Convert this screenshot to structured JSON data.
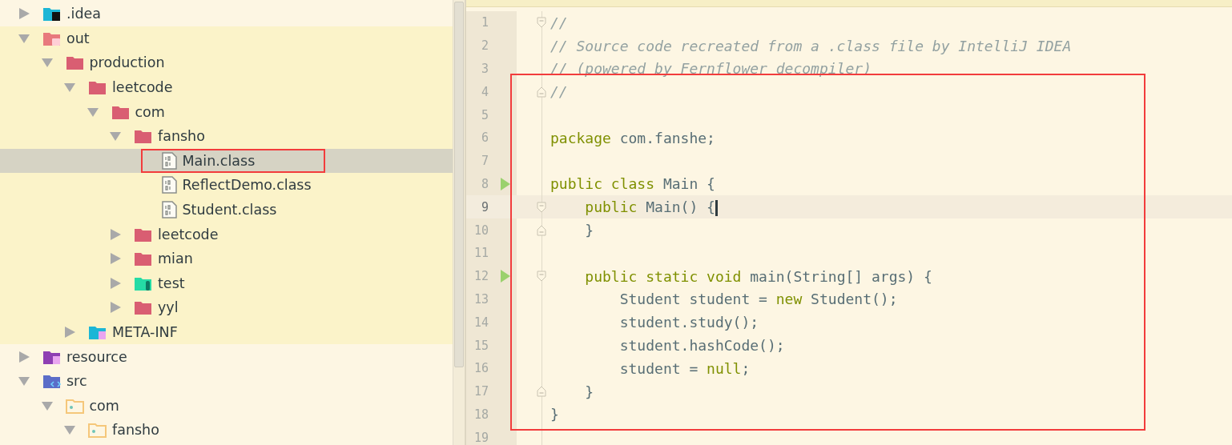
{
  "project_tree": {
    "items": [
      {
        "label": ".idea",
        "kind": "idea-folder",
        "expanded": false,
        "selected": false
      },
      {
        "label": "out",
        "kind": "excluded-folder",
        "expanded": true,
        "selected": false,
        "highlighted": true,
        "children": [
          {
            "label": "production",
            "kind": "folder",
            "expanded": true,
            "selected": false,
            "children": [
              {
                "label": "leetcode",
                "kind": "folder",
                "expanded": true,
                "selected": false,
                "children": [
                  {
                    "label": "com",
                    "kind": "folder",
                    "expanded": true,
                    "selected": false,
                    "children": [
                      {
                        "label": "fansho",
                        "kind": "folder",
                        "expanded": true,
                        "selected": false,
                        "children": [
                          {
                            "label": "Main.class",
                            "kind": "class-file",
                            "selected": true,
                            "boxed": true
                          },
                          {
                            "label": "ReflectDemo.class",
                            "kind": "class-file",
                            "selected": false
                          },
                          {
                            "label": "Student.class",
                            "kind": "class-file",
                            "selected": false
                          }
                        ]
                      },
                      {
                        "label": "leetcode",
                        "kind": "folder",
                        "expanded": false,
                        "selected": false
                      },
                      {
                        "label": "mian",
                        "kind": "folder",
                        "expanded": false,
                        "selected": false
                      },
                      {
                        "label": "test",
                        "kind": "test-folder",
                        "expanded": false,
                        "selected": false
                      },
                      {
                        "label": "yyl",
                        "kind": "folder",
                        "expanded": false,
                        "selected": false
                      }
                    ]
                  }
                ]
              },
              {
                "label": "META-INF",
                "kind": "meta-folder",
                "expanded": false,
                "selected": false
              }
            ]
          }
        ]
      },
      {
        "label": "resource",
        "kind": "resource-folder",
        "expanded": false,
        "selected": false
      },
      {
        "label": "src",
        "kind": "source-folder",
        "expanded": true,
        "selected": false,
        "children": [
          {
            "label": "com",
            "kind": "package",
            "expanded": true,
            "selected": false,
            "children": [
              {
                "label": "fansho",
                "kind": "package",
                "expanded": true,
                "selected": false
              }
            ]
          }
        ]
      }
    ]
  },
  "editor": {
    "boxed": true,
    "lines": [
      {
        "number": "1",
        "current": false,
        "fold_open": true,
        "tokens": [
          {
            "kind": "comment",
            "text": "//"
          }
        ]
      },
      {
        "number": "2",
        "current": false,
        "tokens": [
          {
            "kind": "comment",
            "text": "// Source code recreated from a .class file by IntelliJ IDEA"
          }
        ]
      },
      {
        "number": "3",
        "current": false,
        "tokens": [
          {
            "kind": "comment",
            "text": "// (powered by Fernflower decompiler)"
          }
        ]
      },
      {
        "number": "4",
        "current": false,
        "fold_close": true,
        "tokens": [
          {
            "kind": "comment",
            "text": "//"
          }
        ]
      },
      {
        "number": "5",
        "current": false
      },
      {
        "number": "6",
        "current": false,
        "tokens": [
          {
            "kind": "keyword",
            "text": "package"
          },
          {
            "kind": "plain",
            "text": " com.fanshe;"
          }
        ]
      },
      {
        "number": "7",
        "current": false
      },
      {
        "number": "8",
        "current": false,
        "run": true,
        "tokens": [
          {
            "kind": "keyword",
            "text": "public class"
          },
          {
            "kind": "plain",
            "text": " Main {"
          }
        ]
      },
      {
        "number": "9",
        "current": true,
        "fold_open": true,
        "tokens": [
          {
            "kind": "keyword",
            "text": "    public"
          },
          {
            "kind": "plain",
            "text": " Main() {"
          }
        ]
      },
      {
        "number": "10",
        "current": false,
        "fold_close": true,
        "tokens": [
          {
            "kind": "plain",
            "text": "    }"
          }
        ]
      },
      {
        "number": "11",
        "current": false
      },
      {
        "number": "12",
        "current": false,
        "run": true,
        "fold_open": true,
        "tokens": [
          {
            "kind": "keyword",
            "text": "    public static void"
          },
          {
            "kind": "plain",
            "text": " main(String[] args) {"
          }
        ]
      },
      {
        "number": "13",
        "current": false,
        "tokens": [
          {
            "kind": "plain",
            "text": "        Student student = "
          },
          {
            "kind": "keyword",
            "text": "new"
          },
          {
            "kind": "plain",
            "text": " Student();"
          }
        ]
      },
      {
        "number": "14",
        "current": false,
        "tokens": [
          {
            "kind": "plain",
            "text": "        student.study();"
          }
        ]
      },
      {
        "number": "15",
        "current": false,
        "tokens": [
          {
            "kind": "plain",
            "text": "        student.hashCode();"
          }
        ]
      },
      {
        "number": "16",
        "current": false,
        "tokens": [
          {
            "kind": "plain",
            "text": "        student = "
          },
          {
            "kind": "keyword",
            "text": "null"
          },
          {
            "kind": "plain",
            "text": ";"
          }
        ]
      },
      {
        "number": "17",
        "current": false,
        "fold_close": true,
        "tokens": [
          {
            "kind": "plain",
            "text": "    }"
          }
        ]
      },
      {
        "number": "18",
        "current": false,
        "tokens": [
          {
            "kind": "plain",
            "text": "}"
          }
        ]
      },
      {
        "number": "19",
        "current": false
      }
    ]
  }
}
